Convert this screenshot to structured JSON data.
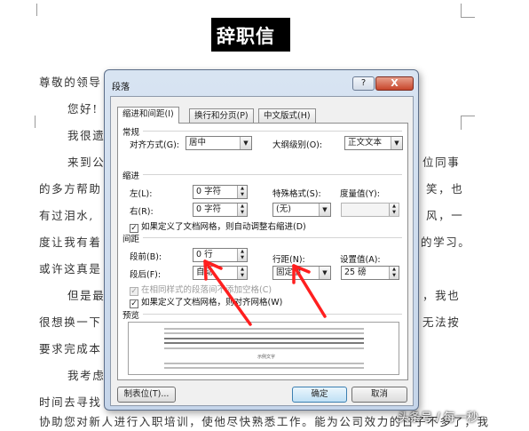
{
  "document": {
    "title": "辞职信",
    "lines": [
      "尊敬的领导",
      "您好!",
      "我很遗",
      "来到公",
      "的多方帮助",
      "有过泪水,",
      "度让我有着",
      "或许这真是",
      "但是最",
      "很想换一下",
      "要求完成本",
      "我考虑",
      "时间去寻找",
      "协助您对新人进行入职培训，使他尽快熟悉工作。能为公司效力的日子不多了，我",
      "位同事",
      "笑，也",
      "风，一",
      "的学习。",
      "，我也",
      "无法按"
    ],
    "watermark": "头条号 / 每一秒"
  },
  "dialog": {
    "title": "段落",
    "help_label": "?",
    "close_label": "X",
    "tabs": [
      "缩进和间距(I)",
      "换行和分页(P)",
      "中文版式(H)"
    ],
    "general": {
      "heading": "常规",
      "alignment_label": "对齐方式(G):",
      "alignment_value": "居中",
      "outline_label": "大纲级别(O):",
      "outline_value": "正文文本"
    },
    "indent": {
      "heading": "缩进",
      "left_label": "左(L):",
      "left_value": "0 字符",
      "right_label": "右(R):",
      "right_value": "0 字符",
      "special_label": "特殊格式(S):",
      "special_value": "(无)",
      "by_label": "度量值(Y):",
      "by_value": "",
      "auto_adjust": "如果定义了文档网格，则自动调整右缩进(D)"
    },
    "spacing": {
      "heading": "间距",
      "before_label": "段前(B):",
      "before_value": "0 行",
      "after_label": "段后(F):",
      "after_value": "自动",
      "line_label": "行距(N):",
      "line_value": "固定值",
      "at_label": "设置值(A):",
      "at_value": "25 磅",
      "no_space_same_style": "在相同样式的段落间不添加空格(C)",
      "snap_to_grid": "如果定义了文档网格，则对齐网格(W)"
    },
    "preview": {
      "heading": "预览",
      "caption": "示例文字"
    },
    "buttons": {
      "tabs": "制表位(T)...",
      "ok": "确定",
      "cancel": "取消"
    }
  }
}
